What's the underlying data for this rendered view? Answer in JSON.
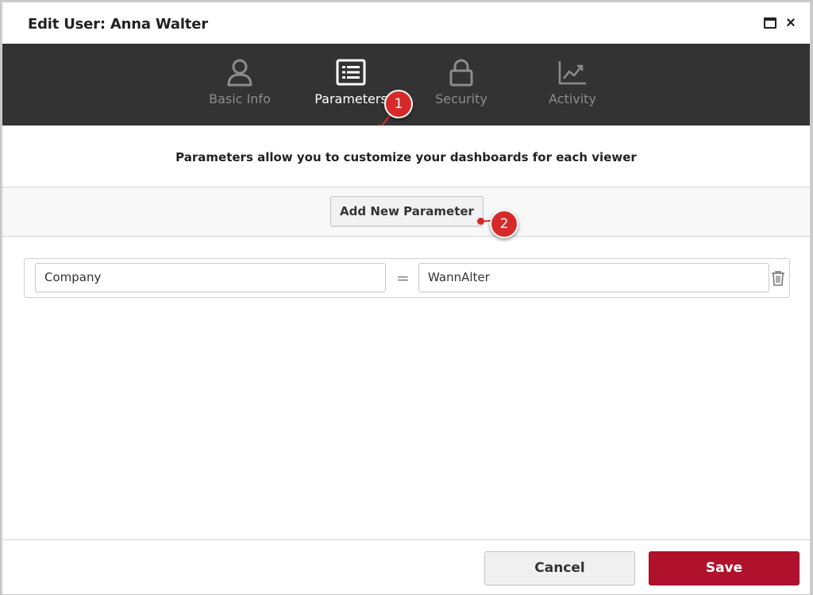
{
  "dialog": {
    "title": "Edit User: Anna Walter",
    "window_controls": {
      "maximize_icon": "maximize-icon",
      "close_label": "×"
    }
  },
  "tabs": [
    {
      "label": "Basic Info",
      "icon": "user-icon",
      "active": false
    },
    {
      "label": "Parameters",
      "icon": "list-icon",
      "active": true
    },
    {
      "label": "Security",
      "icon": "lock-icon",
      "active": false
    },
    {
      "label": "Activity",
      "icon": "chart-trend-icon",
      "active": false
    }
  ],
  "annotations": {
    "callout_1": "1",
    "callout_2": "2"
  },
  "subtitle": "Parameters allow you to customize your dashboards for each viewer",
  "toolbar": {
    "add_label": "Add New Parameter"
  },
  "parameters": [
    {
      "name": "Company",
      "operator": "=",
      "value": "WannAlter"
    }
  ],
  "footer": {
    "cancel_label": "Cancel",
    "save_label": "Save"
  },
  "colors": {
    "tabbar_bg": "#333333",
    "active_tab": "#ffffff",
    "inactive_tab": "#8c8c8c",
    "save_button": "#b0122d",
    "callout": "#d62a2a"
  }
}
